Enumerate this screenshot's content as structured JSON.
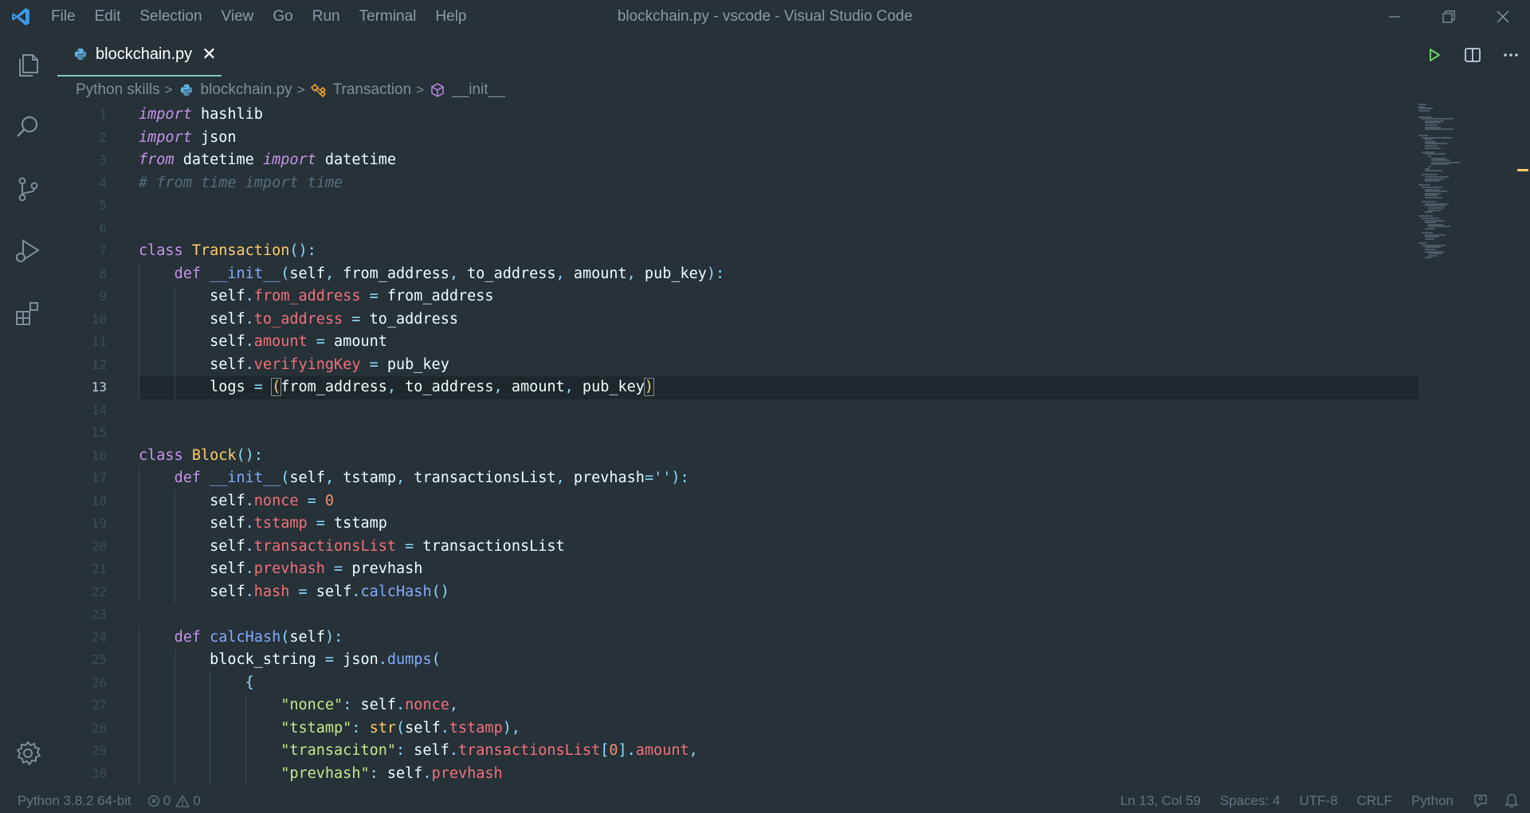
{
  "titlebar": {
    "menu": [
      "File",
      "Edit",
      "Selection",
      "View",
      "Go",
      "Run",
      "Terminal",
      "Help"
    ],
    "window_title": "blockchain.py - vscode - Visual Studio Code"
  },
  "activity_bar": {
    "items": [
      "explorer-icon",
      "search-icon",
      "source-control-icon",
      "run-debug-icon",
      "extensions-icon"
    ],
    "bottom": "gear-icon"
  },
  "tab": {
    "label": "blockchain.py",
    "close": "✕"
  },
  "breadcrumb": {
    "items": [
      "Python skills",
      "blockchain.py",
      "Transaction",
      "__init__"
    ]
  },
  "editor": {
    "current_line": 13,
    "line_numbers": [
      "1",
      "2",
      "3",
      "4",
      "5",
      "6",
      "7",
      "8",
      "9",
      "10",
      "11",
      "12",
      "13",
      "14",
      "15",
      "16",
      "17",
      "18",
      "19",
      "20",
      "21",
      "22",
      "23",
      "24",
      "25",
      "26",
      "27",
      "28",
      "29",
      "30"
    ]
  },
  "statusbar": {
    "interpreter": "Python 3.8.2 64-bit",
    "errors": "0",
    "warnings": "0",
    "cursor": "Ln 13, Col 59",
    "spaces": "Spaces: 4",
    "encoding": "UTF-8",
    "eol": "CRLF",
    "language": "Python"
  },
  "colors": {
    "background": "#263238",
    "accent": "#80cbc4",
    "keyword": "#c792ea",
    "class": "#ffcb6b",
    "function": "#82aaff",
    "property": "#f07178",
    "number": "#f78c6c",
    "string": "#c3e88d"
  }
}
